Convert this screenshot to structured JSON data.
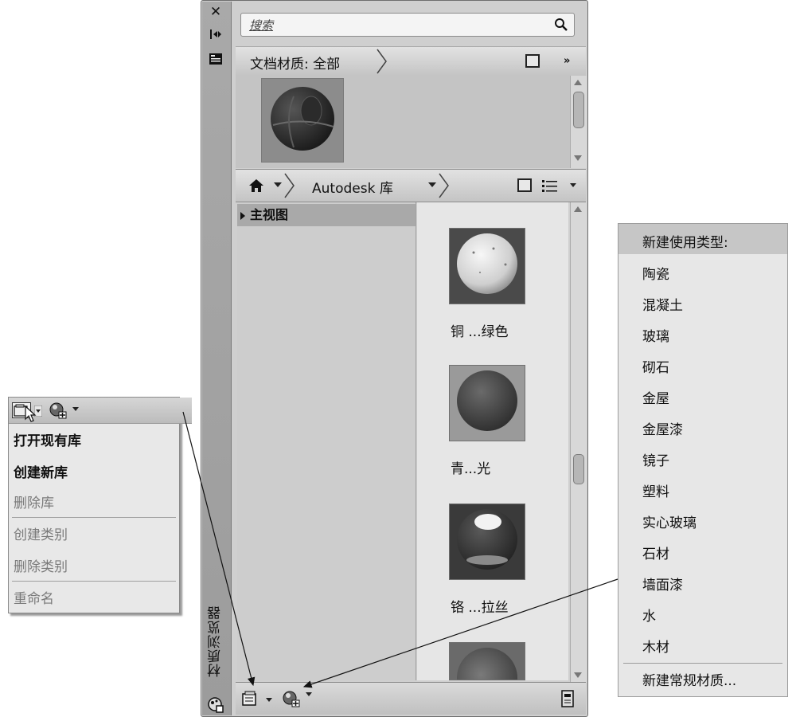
{
  "palette": {
    "title": "材质浏览器",
    "search_placeholder": "搜索",
    "doc_materials_label": "文档材质: 全部",
    "more_glyph": "»",
    "library_name": "Autodesk 库",
    "tree": {
      "items": [
        {
          "label": "主视图"
        }
      ]
    },
    "materials": [
      {
        "label": "铜 ...绿色"
      },
      {
        "label": "青...光"
      },
      {
        "label": "铬 ...拉丝"
      }
    ]
  },
  "library_menu": {
    "items": [
      {
        "label": "打开现有库",
        "enabled": true
      },
      {
        "label": "创建新库",
        "enabled": true
      },
      {
        "label": "删除库",
        "enabled": false
      },
      {
        "label": "创建类别",
        "enabled": false
      },
      {
        "label": "删除类别",
        "enabled": false
      },
      {
        "label": "重命名",
        "enabled": false
      }
    ]
  },
  "material_menu": {
    "header": "新建使用类型:",
    "items": [
      "陶瓷",
      "混凝土",
      "玻璃",
      "砌石",
      "金屋",
      "金屋漆",
      "镜子",
      "塑料",
      "实心玻璃",
      "石材",
      "墙面漆",
      "水",
      "木材"
    ],
    "footer": "新建常规材质..."
  }
}
